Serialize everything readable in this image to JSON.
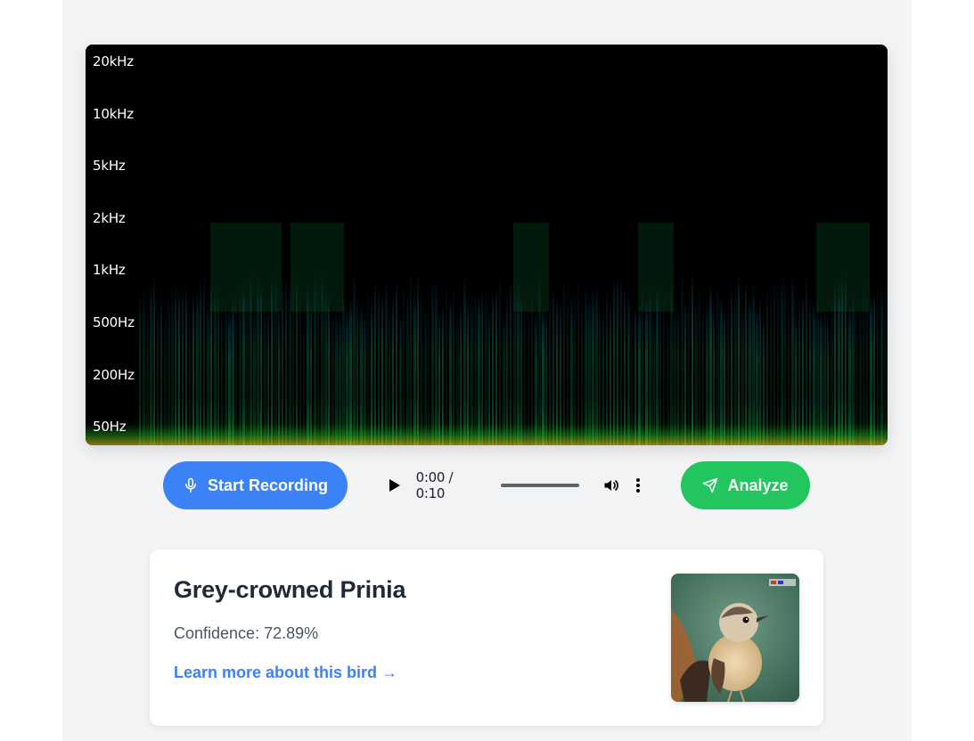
{
  "spectrogram": {
    "frequency_labels": [
      "20kHz",
      "10kHz",
      "5kHz",
      "2kHz",
      "1kHz",
      "500Hz",
      "200Hz",
      "50Hz"
    ]
  },
  "controls": {
    "record_label": "Start Recording",
    "analyze_label": "Analyze",
    "audio": {
      "time_display": "0:00 / 0:10",
      "current_time": "0:00",
      "duration": "0:10"
    }
  },
  "result": {
    "bird_name": "Grey-crowned Prinia",
    "confidence_text": "Confidence: 72.89%",
    "confidence_value": 72.89,
    "link_text": "Learn more about this bird →"
  },
  "colors": {
    "primary_blue": "#3b82f6",
    "analyze_green": "#22c55e",
    "page_background": "#f3f4f6",
    "card_background": "#ffffff",
    "spectrogram_background": "#000000",
    "spectrogram_low": "#0d3b2e",
    "spectrogram_mid": "#0f8a3c",
    "spectrogram_hot": "#e0a010"
  },
  "icons": {
    "record": "microphone-icon",
    "analyze": "send-icon",
    "play": "play-icon",
    "volume": "volume-icon",
    "more": "more-vertical-icon"
  }
}
